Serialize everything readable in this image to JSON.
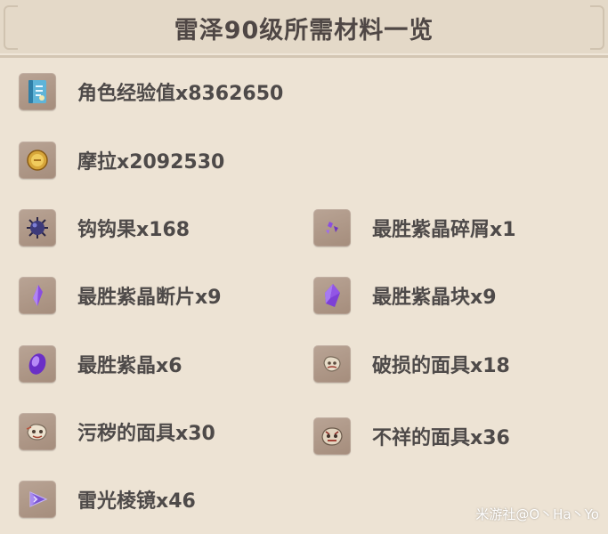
{
  "header": {
    "title": "雷泽90级所需材料一览"
  },
  "items": [
    {
      "label": "角色经验值x8362650",
      "icon": "hero-wit-exp-book-icon"
    },
    {
      "label": "摩拉x2092530",
      "icon": "mora-coin-icon"
    },
    {
      "label": "钩钩果x168",
      "icon": "wolfhook-fruit-icon"
    },
    {
      "label": "最胜紫晶碎屑x1",
      "icon": "vajrada-amethyst-sliver-icon"
    },
    {
      "label": "最胜紫晶断片x9",
      "icon": "vajrada-amethyst-fragment-icon"
    },
    {
      "label": "最胜紫晶块x9",
      "icon": "vajrada-amethyst-chunk-icon"
    },
    {
      "label": "最胜紫晶x6",
      "icon": "vajrada-amethyst-gemstone-icon"
    },
    {
      "label": "破损的面具x18",
      "icon": "damaged-mask-icon"
    },
    {
      "label": "污秽的面具x30",
      "icon": "stained-mask-icon"
    },
    {
      "label": "不祥的面具x36",
      "icon": "ominous-mask-icon"
    },
    {
      "label": "雷光棱镜x46",
      "icon": "lightning-prism-icon"
    }
  ],
  "watermark": "米游社@O丶Ha丶Yo"
}
